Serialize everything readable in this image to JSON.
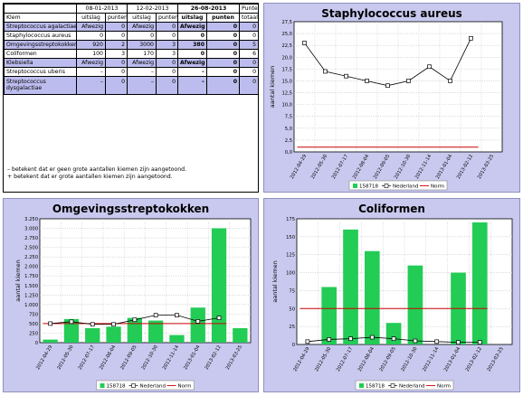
{
  "table": {
    "headers": {
      "col_klem": "Klem",
      "dates": [
        "08-01-2013",
        "12-02-2013",
        "26-08-2013"
      ],
      "sub_uitslag": "uitslag",
      "sub_punten": "punten",
      "punten_title": "Punten",
      "totaal": "totaal"
    },
    "rows": [
      {
        "name": "Streptococcus agalactiae",
        "cells": [
          "Afwezig",
          "0",
          "Afwezig",
          "0",
          "Afwezig",
          "0"
        ],
        "total": "0",
        "hl": true
      },
      {
        "name": "Staphylococcus aureus",
        "cells": [
          "0",
          "0",
          "0",
          "0",
          "0",
          "0"
        ],
        "total": "0",
        "hl": false
      },
      {
        "name": "Omgevingsstreptokokken",
        "cells": [
          "920",
          "2",
          "3000",
          "3",
          "380",
          "0"
        ],
        "total": "5",
        "hl": true
      },
      {
        "name": "Coliformen",
        "cells": [
          "100",
          "3",
          "170",
          "3",
          "0",
          "0"
        ],
        "total": "6",
        "hl": false
      },
      {
        "name": "Klebsiella",
        "cells": [
          "Afwezig",
          "0",
          "Afwezig",
          "0",
          "Afwezig",
          "0"
        ],
        "total": "0",
        "hl": true
      },
      {
        "name": "Streptococcus uberis",
        "cells": [
          "–",
          "0",
          "–",
          "0",
          "–",
          "0"
        ],
        "total": "0",
        "hl": false
      },
      {
        "name": "Streptococcus dysgalactiae",
        "cells": [
          "–",
          "0",
          "–",
          "0",
          "–",
          "0"
        ],
        "total": "0",
        "hl": true
      }
    ],
    "notes": [
      "– betekent dat er geen grote aantallen kiemen zijn aangetoond.",
      "+ betekent dat er grote aantallen kiemen zijn aangetoond."
    ]
  },
  "charts_common": {
    "x_dates": [
      "2012-04-29",
      "2012-05-30",
      "2012-07-17",
      "2012-08-04",
      "2012-09-05",
      "2012-10-30",
      "2012-11-14",
      "2013-01-04",
      "2013-02-12",
      "2013-03-25"
    ],
    "ylabel": "aantal kiemen",
    "legend": [
      "158718",
      "Nederland",
      "Norm"
    ],
    "colors": {
      "bar": "#22cc55",
      "line": "#000000",
      "norm": "#cc0000",
      "grid": "#bbbbbb",
      "panel": "#c9c9ef"
    }
  },
  "chart_data": [
    {
      "type": "line",
      "title": "Staphylococcus aureus",
      "ylabel": "aantal kiemen",
      "ylim": [
        0,
        27.5
      ],
      "ytick_labels": [
        "0,0",
        "2,5",
        "5,0",
        "7,5",
        "10,0",
        "12,5",
        "15,0",
        "17,5",
        "20,0",
        "22,5",
        "25,0",
        "27,5"
      ],
      "series": [
        {
          "name": "158718",
          "values": [
            null,
            null,
            null,
            null,
            null,
            null,
            null,
            null,
            null,
            null
          ]
        },
        {
          "name": "Nederland",
          "values": [
            23,
            17,
            16,
            15,
            14,
            15,
            18,
            15,
            24,
            null
          ]
        },
        {
          "name": "Norm",
          "values": [
            1,
            1,
            1,
            1,
            1,
            1,
            1,
            1,
            1,
            null
          ]
        }
      ]
    },
    {
      "type": "bar",
      "title": "Omgevingsstreptokokken",
      "ylabel": "aantal kiemen",
      "ylim": [
        0,
        3250
      ],
      "ytick_labels": [
        "0",
        "250",
        "500",
        "750",
        "1.000",
        "1.250",
        "1.500",
        "1.750",
        "2.000",
        "2.250",
        "2.500",
        "2.750",
        "3.000",
        "3.250"
      ],
      "series": [
        {
          "name": "158718",
          "values": [
            80,
            620,
            380,
            420,
            650,
            580,
            200,
            920,
            3000,
            380
          ]
        },
        {
          "name": "Nederland",
          "values": [
            500,
            550,
            480,
            480,
            600,
            720,
            720,
            560,
            650,
            null
          ]
        },
        {
          "name": "Norm",
          "values": [
            500,
            500,
            500,
            500,
            500,
            500,
            500,
            500,
            500,
            null
          ]
        }
      ]
    },
    {
      "type": "bar",
      "title": "Coliformen",
      "ylabel": "aantal kiemen",
      "ylim": [
        0,
        175
      ],
      "ytick_labels": [
        "0",
        "25",
        "50",
        "75",
        "100",
        "125",
        "150",
        "175"
      ],
      "series": [
        {
          "name": "158718",
          "values": [
            0,
            80,
            160,
            130,
            30,
            110,
            0,
            100,
            170,
            0
          ]
        },
        {
          "name": "Nederland",
          "values": [
            4,
            7,
            8,
            10,
            8,
            5,
            4,
            3,
            3,
            null
          ]
        },
        {
          "name": "Norm",
          "values": [
            50,
            50,
            50,
            50,
            50,
            50,
            50,
            50,
            50,
            null
          ]
        }
      ]
    }
  ]
}
